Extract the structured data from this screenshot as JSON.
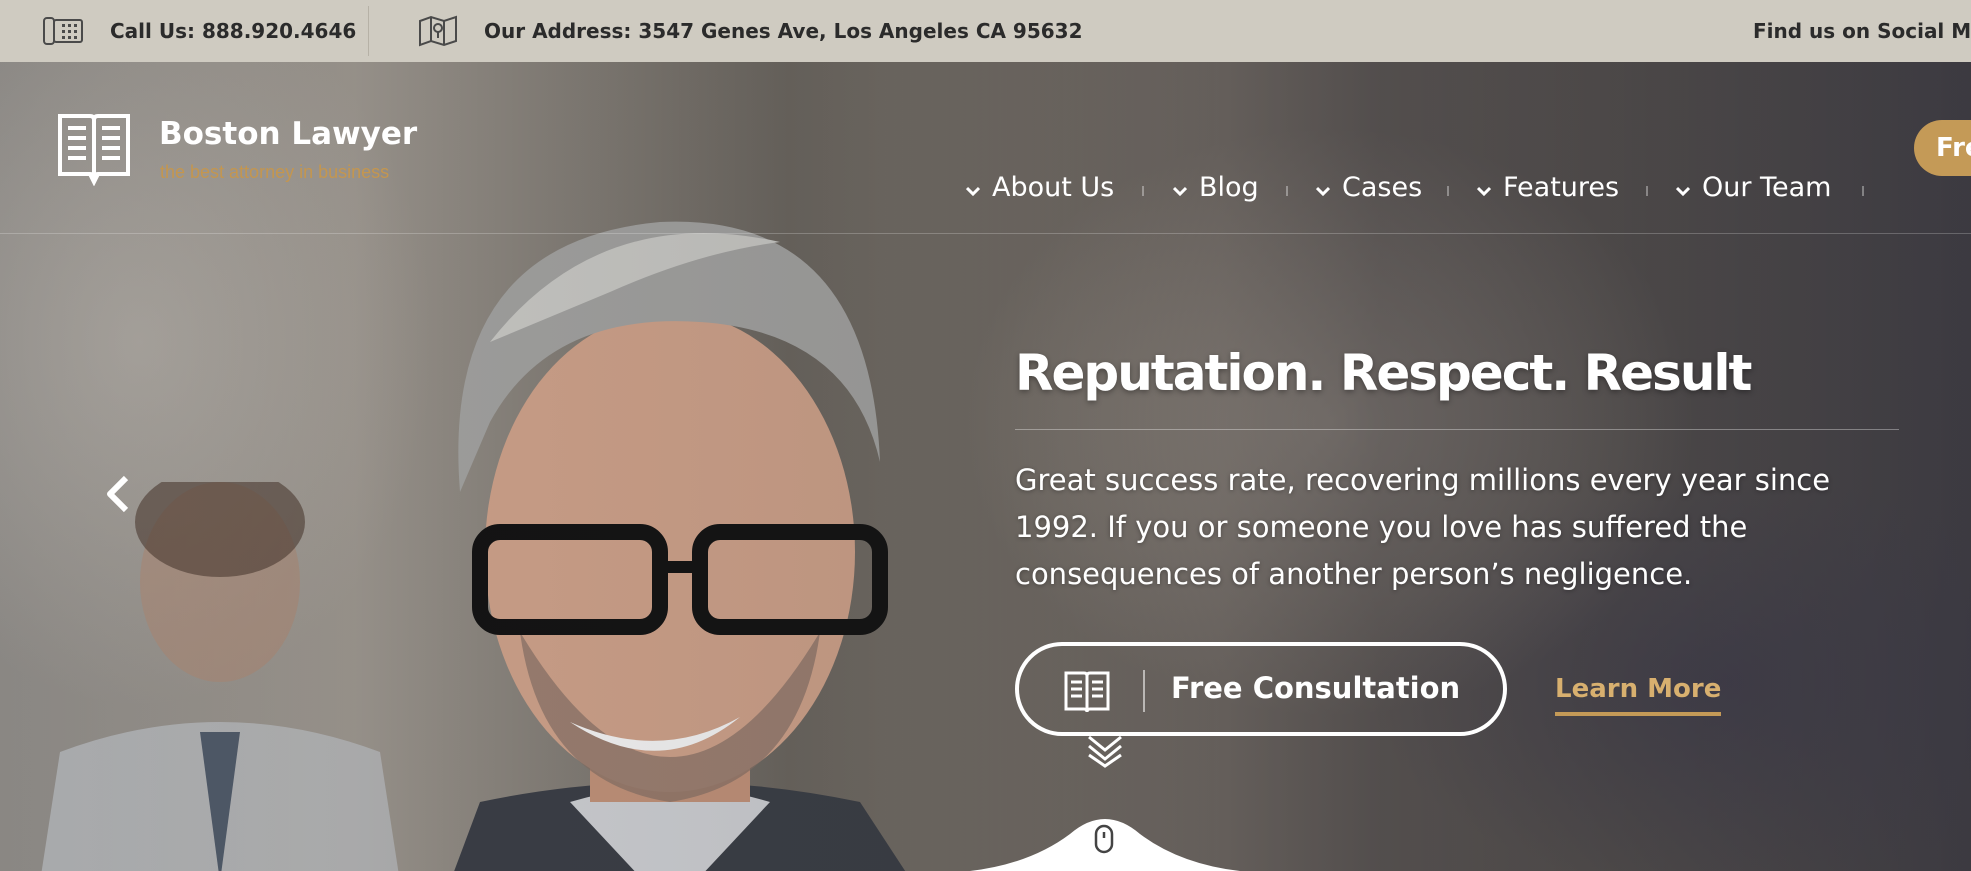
{
  "topbar": {
    "phone_text": "Call Us: 888.920.4646",
    "address_text": "Our Address: 3547 Genes Ave, Los Angeles CA 95632",
    "social_text": "Find us on Social Med",
    "phone_icon": "phone-icon",
    "address_icon": "map-icon"
  },
  "brand": {
    "name": "Boston Lawyer",
    "tagline": "the best attorney in business",
    "logo_icon": "open-book-icon"
  },
  "nav": {
    "items": [
      {
        "label": "About Us"
      },
      {
        "label": "Blog"
      },
      {
        "label": "Cases"
      },
      {
        "label": "Features"
      },
      {
        "label": "Our Team"
      }
    ],
    "cta_label": "Fre"
  },
  "hero": {
    "headline": "Reputation. Respect. Result",
    "description": "Great success rate, recovering millions every year since 1992. If you or someone you love has suffered the consequences of another person’s negligence.",
    "primary_button": "Free Consultation",
    "secondary_link": "Learn More"
  },
  "colors": {
    "accent": "#c49a57",
    "topbar_bg": "#cfcbc1",
    "text_dark": "#2b2b2b"
  }
}
